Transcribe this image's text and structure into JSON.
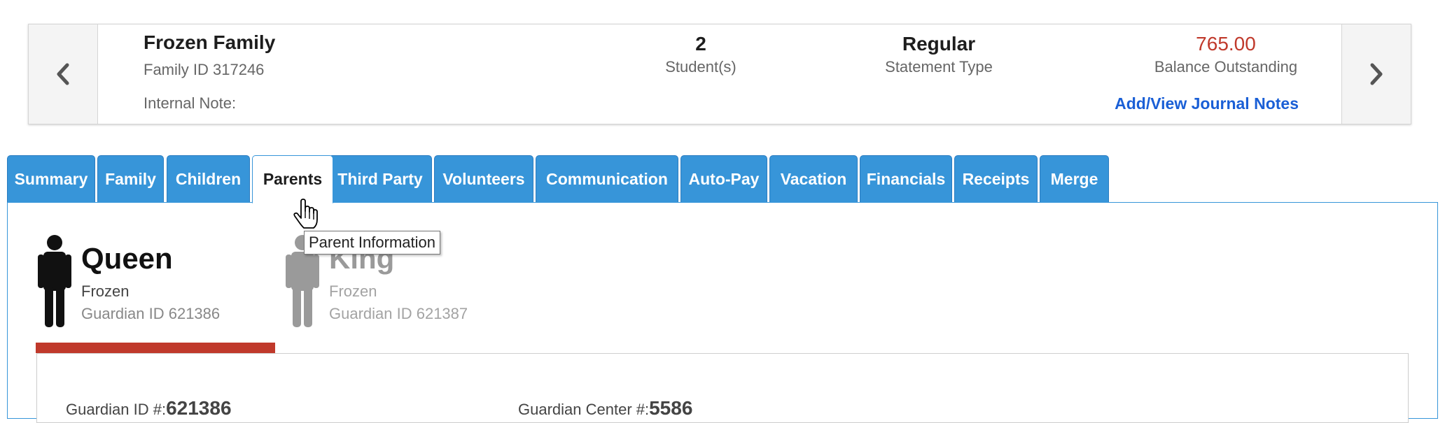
{
  "family": {
    "name": "Frozen Family",
    "id_label": "Family ID 317246",
    "internal_note_label": "Internal Note:",
    "students": {
      "value": "2",
      "label": "Student(s)"
    },
    "statement": {
      "value": "Regular",
      "label": "Statement Type"
    },
    "balance": {
      "value": "765.00",
      "label": "Balance Outstanding"
    },
    "journal_link": "Add/View Journal Notes",
    "prev_icon": "chevron-left-icon",
    "next_icon": "chevron-right-icon"
  },
  "tabs": [
    {
      "label": "Summary"
    },
    {
      "label": "Family"
    },
    {
      "label": "Children"
    },
    {
      "label": "Parents",
      "active": true
    },
    {
      "label": "Third Party"
    },
    {
      "label": "Volunteers"
    },
    {
      "label": "Communication"
    },
    {
      "label": "Auto-Pay"
    },
    {
      "label": "Vacation"
    },
    {
      "label": "Financials"
    },
    {
      "label": "Receipts"
    },
    {
      "label": "Merge"
    }
  ],
  "tooltip": "Parent Information",
  "guardians": [
    {
      "name": "Queen",
      "last_name": "Frozen",
      "id_label": "Guardian ID 621386",
      "selected": true,
      "icon": "person-icon"
    },
    {
      "name": "King",
      "last_name": "Frozen",
      "id_label": "Guardian ID 621387",
      "selected": false,
      "icon": "person-icon"
    }
  ],
  "details": {
    "guardian_id_label": "Guardian ID #:",
    "guardian_id_value": "621386",
    "center_label": "Guardian Center #:",
    "center_value": "5586"
  },
  "colors": {
    "tab_blue": "#3795d9",
    "balance_red": "#c0392b",
    "link_blue": "#1a5fd6",
    "selected_bar": "#c0392b"
  }
}
